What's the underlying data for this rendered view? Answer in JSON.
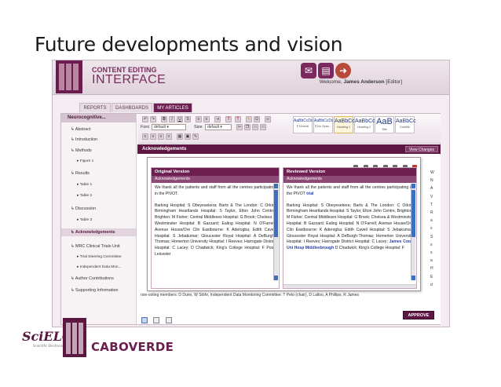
{
  "slide": {
    "title": "Future developments and vision"
  },
  "app": {
    "header": {
      "line1": "CONTENT EDITING",
      "line2": "INTERFACE",
      "welcome": "Welcome,",
      "user_name": "James Anderson",
      "role": "[Editor]"
    },
    "tabs": [
      {
        "label": "REPORTS"
      },
      {
        "label": "DASHBOARDS"
      },
      {
        "label": "MY ARTICLES",
        "active": true
      }
    ],
    "sidebar": {
      "head": "Neurocognitive...",
      "items": [
        {
          "label": "Abstract"
        },
        {
          "label": "Introduction"
        },
        {
          "label": "Methods"
        },
        {
          "label": "Figure 1"
        },
        {
          "label": "Results"
        },
        {
          "label": "Table 1"
        },
        {
          "label": "Table 2"
        },
        {
          "label": "Discussion"
        },
        {
          "label": "Table 3"
        },
        {
          "label": "Acknowledgements"
        },
        {
          "label": "MRC Clinical Trials Unit"
        },
        {
          "label": "Trial Steering Committee"
        },
        {
          "label": "Independent Data Mon..."
        },
        {
          "label": "Author Contributions"
        },
        {
          "label": "Supporting Information"
        }
      ]
    },
    "toolbar": {
      "font_label": "Font",
      "font_value": "default",
      "size_label": "Size",
      "size_value": "default",
      "styles": [
        {
          "sample": "AaBbCcDc",
          "name": "¶ Normal"
        },
        {
          "sample": "AaBbCcDc",
          "name": "¶ No Spac..."
        },
        {
          "sample": "AaBbCc",
          "name": "Heading 1"
        },
        {
          "sample": "AaBbCc",
          "name": "Heading 2"
        },
        {
          "sample": "AaB",
          "name": "Title"
        },
        {
          "sample": "AaBbCc",
          "name": "Subtitle"
        }
      ]
    },
    "ack_bar": {
      "label": "Acknowledgements",
      "view_changes": "View Changes"
    },
    "compare": {
      "original": {
        "head": "Original Version",
        "sub": "Acknowledgements",
        "p1": "We thank all the patients and staff from all the centres participating in the PIVOT.",
        "p2": "Barking Hospital: S Obeyesekera; Barts & The London: C Orkin; Birmingham Heartlands Hospital: S Taylor, Elton John Centre, Brighton: M Fisher; Central Middlesex Hospital: G Brook; Chelsea & Westminster Hospital: B Gazzard; Ealing Hospital: N O'Farrell; Avenue House/Ore Clin Eastbourne: K Aderogba; Edith Cavell Hospital: S Jebakumar; Gloucester Royal Hospital: A DeBurgh-Thomas; Homerton University Hospital: I Reeves; Harrogate District Hospital: C Lacey; D Chadwick; King's College Hospital: F Post; Leicester"
      },
      "reviewed": {
        "head": "Reviewed Version",
        "sub": "Acknowledgements",
        "p1a": "We thank all the patients and staff from all the centres participating in the PIVOT",
        "p1b": "trial",
        "p2a": "Barking Hospital: S Obeyesekera; Barts & The London: C Orkin; Birmingham Heartlands Hospital: S Taylor, Elton John Centre, Brighton: M Fisher; Central Middlesex Hospital: G Brook; Chelsea & Westminster Hospital: B Gazzard; Ealing Hospital: N O'Farrell; Avenue House/Ore Clin Eastbourne: K Aderogba; Edith Cavell Hospital: S Jebakumar; Gloucester Royal Hospital: A DeBurgh-Thomas; Homerton University Hospital: I Reeves; Harrogate District Hospital: C Lacey;",
        "p2b": "James Cook Uni Hosp Middlesbrough",
        "p2c": "D Chadwick; King's College Hospital: F"
      }
    },
    "behind_text": "non-voting members: D Dunn, W Stöhr, Independent Data Monitoring Committee: T Peto (chair), D Lalloo, A Phillips, R James",
    "right_letters": [
      "W",
      "N",
      "A",
      "V",
      "T",
      "R",
      "a",
      "s",
      "S",
      "s",
      "s",
      "a",
      "H",
      "E",
      "d"
    ],
    "approve": "APPROVE"
  },
  "footer": {
    "scielo": "SciELO",
    "scielo_sub": "Scientific Electronic Library Online",
    "caboverde": "CABOVERDE"
  }
}
